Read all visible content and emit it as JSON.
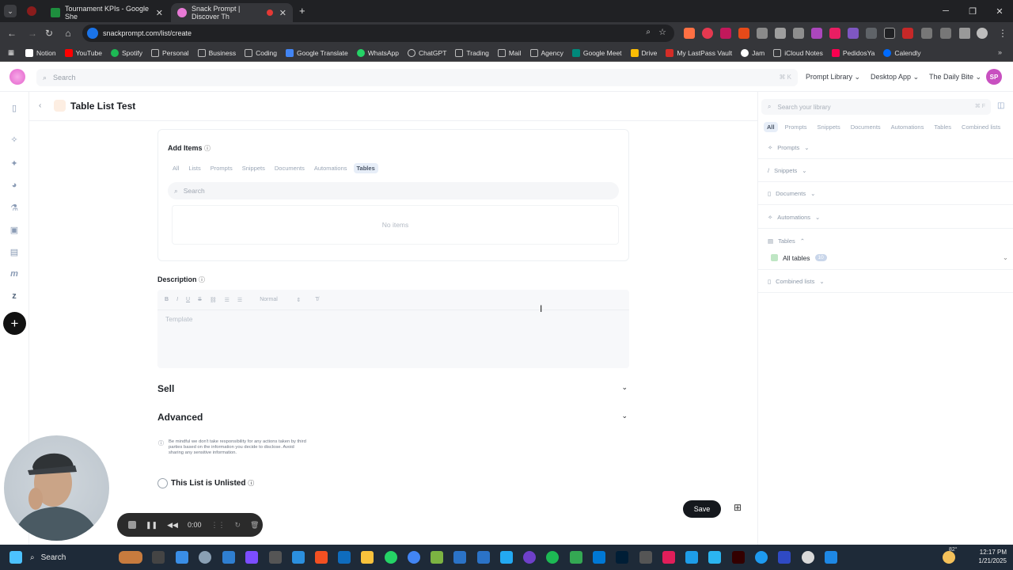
{
  "browser": {
    "tabs": [
      {
        "title": "Tournament KPIs - Google She",
        "favicon_color": "#1e8e3e"
      },
      {
        "title": "Snack Prompt | Discover Th",
        "favicon_color": "#e87ad6"
      }
    ],
    "new_tab_glyph": "+",
    "url": "snackprompt.com/list/create",
    "bookmarks": [
      {
        "label": "Notion",
        "color": "#ffffff"
      },
      {
        "label": "YouTube",
        "color": "#ff0000"
      },
      {
        "label": "Spotify",
        "color": "#1db954"
      },
      {
        "label": "Personal",
        "color": "#9aa0a6"
      },
      {
        "label": "Business",
        "color": "#9aa0a6"
      },
      {
        "label": "Coding",
        "color": "#9aa0a6"
      },
      {
        "label": "Google Translate",
        "color": "#4285f4"
      },
      {
        "label": "WhatsApp",
        "color": "#25d366"
      },
      {
        "label": "ChatGPT",
        "color": "#cccccc"
      },
      {
        "label": "Trading",
        "color": "#9aa0a6"
      },
      {
        "label": "Mail",
        "color": "#9aa0a6"
      },
      {
        "label": "Agency",
        "color": "#9aa0a6"
      },
      {
        "label": "Google Meet",
        "color": "#00897b"
      },
      {
        "label": "Drive",
        "color": "#fbbc04"
      },
      {
        "label": "My LastPass Vault",
        "color": "#d32d27"
      },
      {
        "label": "Jam",
        "color": "#ffffff"
      },
      {
        "label": "iCloud Notes",
        "color": "#9aa0a6"
      },
      {
        "label": "PedidosYa",
        "color": "#fa0050"
      },
      {
        "label": "Calendly",
        "color": "#006bff"
      }
    ]
  },
  "app": {
    "search_placeholder": "Search",
    "search_shortcut": "⌘ K",
    "menus": [
      "Prompt Library",
      "Desktop App",
      "The Daily Bite"
    ],
    "avatar_initials": "SP",
    "page_title": "Table List Test",
    "add_items": {
      "heading": "Add Items",
      "filters": [
        "All",
        "Lists",
        "Prompts",
        "Snippets",
        "Documents",
        "Automations",
        "Tables"
      ],
      "active_filter": "Tables",
      "search_placeholder": "Search",
      "empty_text": "No items"
    },
    "description": {
      "heading": "Description",
      "format_label": "Normal",
      "placeholder": "Template"
    },
    "sell_label": "Sell",
    "advanced_label": "Advanced",
    "disclaimer": "Be mindful we don't take responsibility for any actions taken by third parties based on the information you decide to disclose. Avoid sharing any sensitive information.",
    "unlisted_label": "This List is Unlisted",
    "save_label": "Save"
  },
  "library": {
    "search_placeholder": "Search your library",
    "search_shortcut": "⌘ F",
    "filters": [
      "All",
      "Prompts",
      "Snippets",
      "Documents",
      "Automations",
      "Tables",
      "Combined lists"
    ],
    "active_filter": "All",
    "sections": [
      "Prompts",
      "Snippets",
      "Documents",
      "Automations",
      "Tables",
      "Combined lists"
    ],
    "tables_item": {
      "label": "All tables",
      "count": "10"
    }
  },
  "recorder": {
    "time": "0:00"
  },
  "taskbar": {
    "search_label": "Search",
    "weather": "82°",
    "time": "12:17 PM",
    "date": "1/21/2025"
  }
}
